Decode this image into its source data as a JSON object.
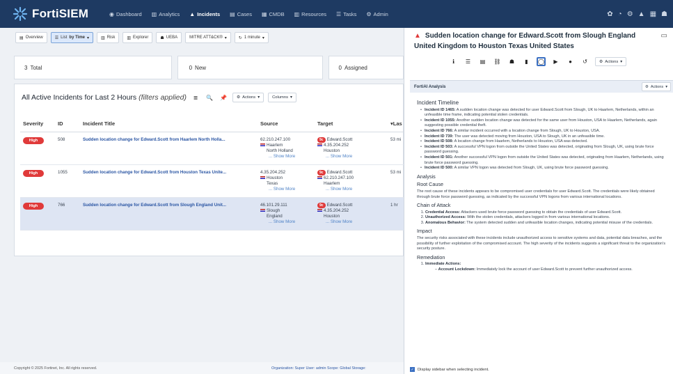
{
  "app": {
    "name": "FortiSIEM"
  },
  "nav": [
    {
      "icon": "◉",
      "label": "Dashboard"
    },
    {
      "icon": "▥",
      "label": "Analytics"
    },
    {
      "icon": "▲",
      "label": "Incidents"
    },
    {
      "icon": "▤",
      "label": "Cases"
    },
    {
      "icon": "▦",
      "label": "CMDB"
    },
    {
      "icon": "▥",
      "label": "Resources"
    },
    {
      "icon": "☰",
      "label": "Tasks"
    },
    {
      "icon": "⚙",
      "label": "Admin"
    }
  ],
  "toolbar": {
    "overview": "Overview",
    "list_by": "List",
    "list_by_bold": "by Time",
    "risk": "Risk",
    "explorer": "Explorer",
    "ueba": "UEBA",
    "mitre": "MITRE ATT&CK®",
    "interval": "1 minute"
  },
  "stats": [
    {
      "count": "3",
      "label": "Total"
    },
    {
      "count": "0",
      "label": "New"
    },
    {
      "count": "0",
      "label": "Assigned"
    }
  ],
  "panel": {
    "title": "All Active Incidents for Last 2 Hours",
    "filter_note": "(filters applied)",
    "actions": "Actions",
    "columns": "Columns"
  },
  "table": {
    "headers": [
      "Severity",
      "ID",
      "Incident Title",
      "Source",
      "Target",
      "▾Las"
    ],
    "show_more": "... Show More",
    "rows": [
      {
        "severity": "High",
        "id": "508",
        "title": "Sudden location change for Edward.Scott from Haarlem North Holla...",
        "source": [
          "62.210.247.100",
          "Haarlem",
          "North Holland"
        ],
        "target_badge": "9c",
        "target": [
          "Edward.Scott",
          "4.35.204.252",
          "Houston"
        ],
        "last": "53 mi"
      },
      {
        "severity": "High",
        "id": "1055",
        "title": "Sudden location change for Edward.Scott from Houston Texas Unite...",
        "source": [
          "4.35.204.252",
          "Houston",
          "Texas"
        ],
        "target_badge": "9c",
        "target": [
          "Edward.Scott",
          "62.210.247.100",
          "Haarlem"
        ],
        "last": "53 mi"
      },
      {
        "severity": "High",
        "id": "766",
        "title": "Sudden location change for Edward.Scott from Slough England Unit...",
        "source": [
          "46.101.29.111",
          "Slough",
          "England"
        ],
        "target_badge": "9c",
        "target": [
          "Edward.Scott",
          "4.35.204.252",
          "Houston"
        ],
        "last": "1 hr"
      }
    ]
  },
  "footer": {
    "copyright": "Copyright © 2025 Fortinet, Inc. All rights reserved.",
    "org": "Organization: Super   User: admin   Scope: Global   Storage:"
  },
  "sidebar": {
    "title": "Sudden location change for Edward.Scott from Slough England United Kingdom to Houston Texas United States",
    "actions": "Actions",
    "ai_header": "FortiAI Analysis",
    "ai_actions": "Actions",
    "timeline_heading": "Incident Timeline",
    "timeline": [
      {
        "id": "Incident ID 1465:",
        "text": "A sudden location change was detected for user Edward.Scott from Slough, UK to Haarlem, Netherlands, within an unfeasible time frame, indicating potential stolen credentials."
      },
      {
        "id": "Incident ID 1055:",
        "text": "Another sudden location change was detected for the same user from Houston, USA to Haarlem, Netherlands, again suggesting possible credential theft."
      },
      {
        "id": "Incident ID 766:",
        "text": "A similar incident occurred with a location change from Slough, UK to Houston, USA."
      },
      {
        "id": "Incident ID 739:",
        "text": "The user was detected moving from Houston, USA to Slough, UK in an unfeasible time."
      },
      {
        "id": "Incident ID 508:",
        "text": "A location change from Haarlem, Netherlands to Houston, USA was detected."
      },
      {
        "id": "Incident ID 503:",
        "text": "A successful VPN logon from outside the United States was detected, originating from Slough, UK, using brute force password guessing."
      },
      {
        "id": "Incident ID 501:",
        "text": "Another successful VPN logon from outside the United States was detected, originating from Haarlem, Netherlands, using brute force password guessing."
      },
      {
        "id": "Incident ID 500:",
        "text": "A similar VPN logon was detected from Slough, UK, using brute force password guessing."
      }
    ],
    "analysis_heading": "Analysis",
    "root_cause_heading": "Root Cause",
    "root_cause": "The root cause of these incidents appears to be compromised user credentials for user Edward.Scott. The credentials were likely obtained through brute force password guessing, as indicated by the successful VPN logons from various international locations.",
    "chain_heading": "Chain of Attack",
    "chain": [
      {
        "label": "Credential Access:",
        "text": "Attackers used brute force password guessing to obtain the credentials of user Edward.Scott."
      },
      {
        "label": "Unauthorized Access:",
        "text": "With the stolen credentials, attackers logged in from various international locations."
      },
      {
        "label": "Anomalous Behavior:",
        "text": "The system detected sudden and unfeasible location changes, indicating potential misuse of the credentials."
      }
    ],
    "impact_heading": "Impact",
    "impact": "The security risks associated with these incidents include unauthorized access to sensitive systems and data, potential data breaches, and the possibility of further exploitation of the compromised account. The high severity of the incidents suggests a significant threat to the organization's security posture.",
    "remediation_heading": "Remediation",
    "remediation_item": "Immediate Actions:",
    "lockdown_label": "Account Lockdown:",
    "lockdown_text": "Immediately lock the account of user Edward.Scott to prevent further unauthorized access.",
    "display_checkbox": "Display sidebar when selecting incident."
  }
}
